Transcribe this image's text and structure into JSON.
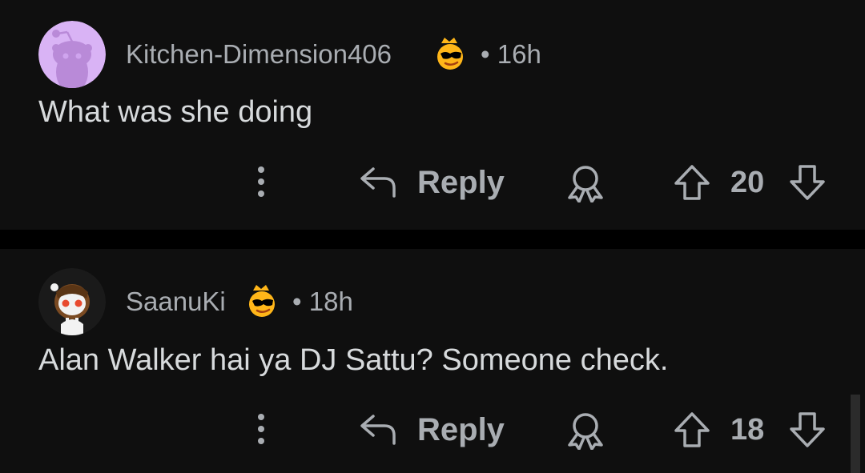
{
  "comments": [
    {
      "username": "Kitchen-Dimension406",
      "separator": "•",
      "time": "16h",
      "body": "What was she doing",
      "reply_label": "Reply",
      "votes": "20",
      "avatar_color": "#d9b3f5"
    },
    {
      "username": "SaanuKi",
      "separator": "•",
      "time": "18h",
      "body": "Alan Walker hai ya DJ Sattu? Someone check.",
      "reply_label": "Reply",
      "votes": "18",
      "avatar_color": "#1a1a1a"
    }
  ],
  "icons": {
    "more": "vertical-ellipsis-icon",
    "reply": "reply-arrow-icon",
    "award": "award-ribbon-icon",
    "upvote": "up-arrow-icon",
    "downvote": "down-arrow-icon",
    "flair": "sunglasses-emoji-icon"
  },
  "colors": {
    "background": "#000000",
    "card": "#0f0f0f",
    "meta_text": "#a9adb2",
    "body_text": "#d7dadc",
    "flair_yellow": "#ffb619"
  }
}
